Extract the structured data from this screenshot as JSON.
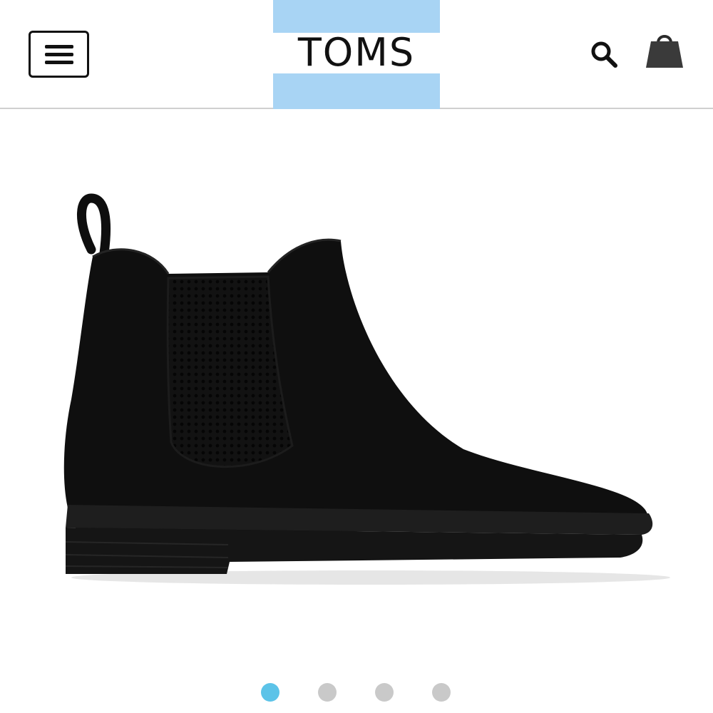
{
  "header": {
    "logo_text": "TOMS",
    "brand_color": "#a8d4f4",
    "menu_icon": "hamburger-menu-icon",
    "search_icon": "search-icon",
    "cart_icon": "shopping-bag-icon"
  },
  "product": {
    "image_description_icon": "chelsea-boot-image",
    "boot_color": "#0d0d0d"
  },
  "carousel": {
    "total_slides": 4,
    "active_index": 0,
    "active_color": "#5cc3e8",
    "inactive_color": "#c9c9c9"
  }
}
